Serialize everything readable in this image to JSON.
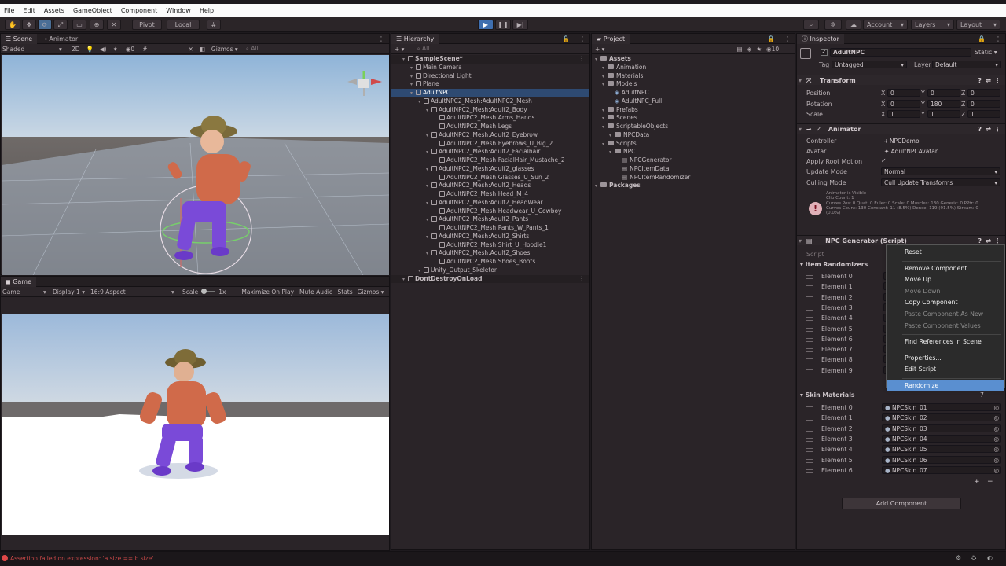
{
  "menu": [
    "File",
    "Edit",
    "Assets",
    "GameObject",
    "Component",
    "Window",
    "Help"
  ],
  "toolbar": {
    "pivot": "Pivot",
    "local": "Local",
    "account": "Account",
    "layers": "Layers",
    "layout": "Layout"
  },
  "scene": {
    "tabs": [
      "Scene",
      "Animator"
    ],
    "shading": "Shaded",
    "mode2d": "2D",
    "gizmos": "Gizmos",
    "search_all": "All"
  },
  "game": {
    "tab": "Game",
    "view": "Game",
    "display": "Display 1",
    "aspect": "16:9 Aspect",
    "scale_label": "Scale",
    "scale_value": "1x",
    "maximize": "Maximize On Play",
    "mute": "Mute Audio",
    "stats": "Stats",
    "gizmos": "Gizmos"
  },
  "hierarchy": {
    "tab": "Hierarchy",
    "search_all": "All",
    "items": [
      {
        "label": "SampleScene*",
        "depth": 0,
        "kind": "scene"
      },
      {
        "label": "Main Camera",
        "depth": 1,
        "kind": "obj"
      },
      {
        "label": "Directional Light",
        "depth": 1,
        "kind": "obj"
      },
      {
        "label": "Plane",
        "depth": 1,
        "kind": "obj"
      },
      {
        "label": "AdultNPC",
        "depth": 1,
        "kind": "obj",
        "selected": true
      },
      {
        "label": "AdultNPC2_Mesh:AdultNPC2_Mesh",
        "depth": 2,
        "kind": "obj"
      },
      {
        "label": "AdultNPC2_Mesh:Adult2_Body",
        "depth": 3,
        "kind": "obj"
      },
      {
        "label": "AdultNPC2_Mesh:Arms_Hands",
        "depth": 4,
        "kind": "obj"
      },
      {
        "label": "AdultNPC2_Mesh:Legs",
        "depth": 4,
        "kind": "obj"
      },
      {
        "label": "AdultNPC2_Mesh:Adult2_Eyebrow",
        "depth": 3,
        "kind": "obj"
      },
      {
        "label": "AdultNPC2_Mesh:Eyebrows_U_Big_2",
        "depth": 4,
        "kind": "obj"
      },
      {
        "label": "AdultNPC2_Mesh:Adult2_Facialhair",
        "depth": 3,
        "kind": "obj"
      },
      {
        "label": "AdultNPC2_Mesh:FacialHair_Mustache_2",
        "depth": 4,
        "kind": "obj"
      },
      {
        "label": "AdultNPC2_Mesh:Adult2_glasses",
        "depth": 3,
        "kind": "obj"
      },
      {
        "label": "AdultNPC2_Mesh:Glasses_U_Sun_2",
        "depth": 4,
        "kind": "obj"
      },
      {
        "label": "AdultNPC2_Mesh:Adult2_Heads",
        "depth": 3,
        "kind": "obj"
      },
      {
        "label": "AdultNPC2_Mesh:Head_M_4",
        "depth": 4,
        "kind": "obj"
      },
      {
        "label": "AdultNPC2_Mesh:Adult2_HeadWear",
        "depth": 3,
        "kind": "obj"
      },
      {
        "label": "AdultNPC2_Mesh:Headwear_U_Cowboy",
        "depth": 4,
        "kind": "obj"
      },
      {
        "label": "AdultNPC2_Mesh:Adult2_Pants",
        "depth": 3,
        "kind": "obj"
      },
      {
        "label": "AdultNPC2_Mesh:Pants_W_Pants_1",
        "depth": 4,
        "kind": "obj"
      },
      {
        "label": "AdultNPC2_Mesh:Adult2_Shirts",
        "depth": 3,
        "kind": "obj"
      },
      {
        "label": "AdultNPC2_Mesh:Shirt_U_Hoodie1",
        "depth": 4,
        "kind": "obj"
      },
      {
        "label": "AdultNPC2_Mesh:Adult2_Shoes",
        "depth": 3,
        "kind": "obj"
      },
      {
        "label": "AdultNPC2_Mesh:Shoes_Boots",
        "depth": 4,
        "kind": "obj"
      },
      {
        "label": "Unity_Output_Skeleton",
        "depth": 2,
        "kind": "obj"
      },
      {
        "label": "DontDestroyOnLoad",
        "depth": 0,
        "kind": "scene"
      }
    ]
  },
  "project": {
    "tab": "Project",
    "count": "10",
    "items": [
      {
        "label": "Assets",
        "depth": 0,
        "bold": true
      },
      {
        "label": "Animation",
        "depth": 1
      },
      {
        "label": "Materials",
        "depth": 1
      },
      {
        "label": "Models",
        "depth": 1
      },
      {
        "label": "AdultNPC",
        "depth": 2,
        "kind": "model"
      },
      {
        "label": "AdultNPC_Full",
        "depth": 2,
        "kind": "model"
      },
      {
        "label": "Prefabs",
        "depth": 1
      },
      {
        "label": "Scenes",
        "depth": 1
      },
      {
        "label": "ScriptableObjects",
        "depth": 1
      },
      {
        "label": "NPCData",
        "depth": 2
      },
      {
        "label": "Scripts",
        "depth": 1
      },
      {
        "label": "NPC",
        "depth": 2
      },
      {
        "label": "NPCGenerator",
        "depth": 3,
        "kind": "script"
      },
      {
        "label": "NPCItemData",
        "depth": 3,
        "kind": "script"
      },
      {
        "label": "NPCItemRandomizer",
        "depth": 3,
        "kind": "script"
      },
      {
        "label": "Packages",
        "depth": 0,
        "bold": true
      }
    ]
  },
  "inspector": {
    "tab": "Inspector",
    "name": "AdultNPC",
    "static": "Static",
    "tag_label": "Tag",
    "tag": "Untagged",
    "layer_label": "Layer",
    "layer": "Default",
    "transform": {
      "title": "Transform",
      "rows": [
        {
          "label": "Position",
          "x": "0",
          "y": "0",
          "z": "0"
        },
        {
          "label": "Rotation",
          "x": "0",
          "y": "180",
          "z": "0"
        },
        {
          "label": "Scale",
          "x": "1",
          "y": "1",
          "z": "1"
        }
      ]
    },
    "animator": {
      "title": "Animator",
      "controller_label": "Controller",
      "controller": "NPCDemo",
      "avatar_label": "Avatar",
      "avatar": "AdultNPCAvatar",
      "apply_label": "Apply Root Motion",
      "update_label": "Update Mode",
      "update": "Normal",
      "culling_label": "Culling Mode",
      "culling": "Cull Update Transforms",
      "info": [
        "Animator is Visible",
        "Clip Count: 1",
        "Curves Pos: 0 Quat: 0 Euler: 0 Scale: 0 Muscles: 130 Generic: 0 PPtr: 0",
        "Curves Count: 130 Constant: 11 (8.5%) Dense: 119 (91.5%) Stream: 0",
        "(0.0%)"
      ]
    },
    "npc_generator": {
      "title": "NPC Generator (Script)",
      "script_label": "Script",
      "item_randomizers": "Item Randomizers",
      "elements": [
        "Element 0",
        "Element 1",
        "Element 2",
        "Element 3",
        "Element 4",
        "Element 5",
        "Element 6",
        "Element 7",
        "Element 8",
        "Element 9"
      ],
      "skin_materials": "Skin Materials",
      "skin_count": "7",
      "skins": [
        {
          "label": "Element 0",
          "value": "NPCSkin_01"
        },
        {
          "label": "Element 1",
          "value": "NPCSkin_02"
        },
        {
          "label": "Element 2",
          "value": "NPCSkin_03"
        },
        {
          "label": "Element 3",
          "value": "NPCSkin_04"
        },
        {
          "label": "Element 4",
          "value": "NPCSkin_05"
        },
        {
          "label": "Element 5",
          "value": "NPCSkin_06"
        },
        {
          "label": "Element 6",
          "value": "NPCSkin_07"
        }
      ]
    },
    "add_component": "Add Component"
  },
  "context_menu": [
    {
      "label": "Reset",
      "disabled": false
    },
    {
      "sep": true
    },
    {
      "label": "Remove Component",
      "disabled": false
    },
    {
      "label": "Move Up",
      "disabled": false
    },
    {
      "label": "Move Down",
      "disabled": true
    },
    {
      "label": "Copy Component",
      "disabled": false
    },
    {
      "label": "Paste Component As New",
      "disabled": true
    },
    {
      "label": "Paste Component Values",
      "disabled": true
    },
    {
      "sep": true
    },
    {
      "label": "Find References In Scene",
      "disabled": false
    },
    {
      "sep": true
    },
    {
      "label": "Properties...",
      "disabled": false
    },
    {
      "label": "Edit Script",
      "disabled": false
    },
    {
      "sep": true
    },
    {
      "label": "Randomize",
      "disabled": false,
      "highlighted": true
    }
  ],
  "status": {
    "error": "Assertion failed on expression: 'a.size == b.size'"
  },
  "colors": {
    "accent": "#3b6ea8",
    "menu_highlight": "#5a8fd0",
    "selection": "#2e4a72",
    "error": "#e04848"
  }
}
